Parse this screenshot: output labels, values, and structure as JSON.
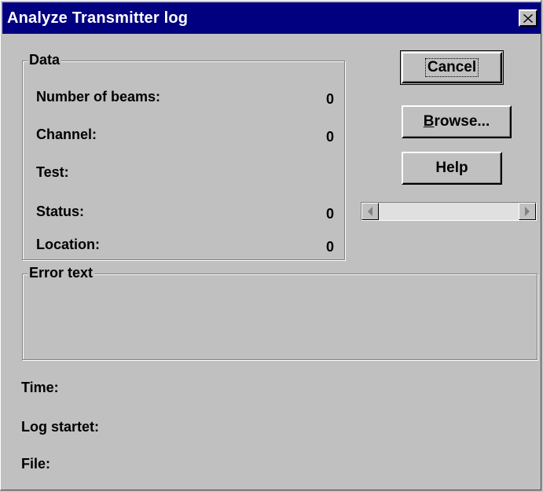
{
  "window": {
    "title": "Analyze Transmitter log",
    "close_icon": "close-icon"
  },
  "data_group": {
    "legend": "Data",
    "fields": [
      {
        "label": "Number of beams:",
        "value": "0"
      },
      {
        "label": "Channel:",
        "value": "0"
      },
      {
        "label": "Test:",
        "value": ""
      },
      {
        "label": "Status:",
        "value": "0"
      },
      {
        "label": "Location:",
        "value": "0"
      }
    ]
  },
  "buttons": {
    "cancel": "Cancel",
    "browse_mnemonic": "B",
    "browse_rest": "rowse...",
    "help": "Help"
  },
  "scrollbar": {
    "left_icon": "scroll-left-arrow-icon",
    "right_icon": "scroll-right-arrow-icon"
  },
  "error_group": {
    "legend": "Error text",
    "text": ""
  },
  "info": {
    "time_label": "Time:",
    "log_started_label": "Log startet:",
    "file_label": "File:"
  }
}
